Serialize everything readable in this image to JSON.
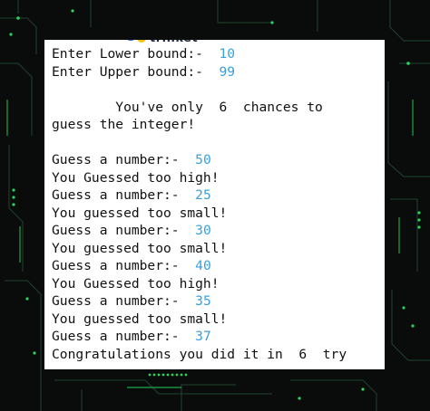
{
  "header": {
    "logo_text": "trinket"
  },
  "console": {
    "lower_prompt": "Enter Lower bound:-",
    "lower_value": "10",
    "upper_prompt": "Enter Upper bound:-",
    "upper_value": "99",
    "chances_prefix": "You've only",
    "chances_value": "6",
    "chances_suffix": "chances to",
    "chances_line2": "guess the integer!",
    "guess_prompt": "Guess a number:-",
    "guesses": [
      {
        "value": "50",
        "response": "You Guessed too high!"
      },
      {
        "value": "25",
        "response": "You guessed too small!"
      },
      {
        "value": "30",
        "response": "You guessed too small!"
      },
      {
        "value": "40",
        "response": "You Guessed too high!"
      },
      {
        "value": "35",
        "response": "You guessed too small!"
      },
      {
        "value": "37",
        "response": ""
      }
    ],
    "congrats_prefix": "Congratulations you did it in",
    "congrats_value": "6",
    "congrats_suffix": "try"
  },
  "colors": {
    "background": "#0a0c0b",
    "circuit_green": "#22c55e",
    "input_value": "#3aa0dd",
    "console_bg": "#ffffff",
    "text": "#111111"
  }
}
